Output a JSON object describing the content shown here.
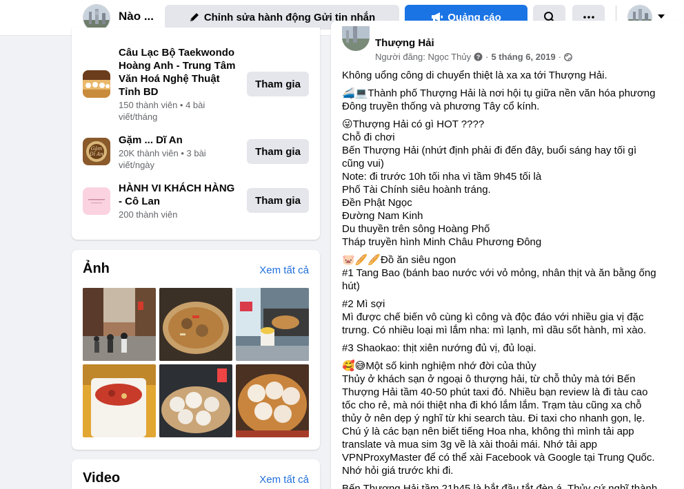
{
  "topbar": {
    "group_name": "Nào ...",
    "edit_label": "Chỉnh sửa hành động Gửi tin nhắn",
    "ads_label": "Quảng cáo",
    "search_icon": "search-icon",
    "more_icon": "more-icon"
  },
  "groups": [
    {
      "title": "Câu Lạc Bộ Taekwondo Hoàng Anh - Trung Tâm Văn Hoá Nghệ Thuật Tỉnh BD",
      "meta": "150 thành viên • 4 bài viết/tháng",
      "join": "Tham gia"
    },
    {
      "title": "Gặm ... Dĩ An",
      "meta": "20K thành viên • 3 bài viết/ngày",
      "join": "Tham gia",
      "thumb_text": "Gặm Dĩ An"
    },
    {
      "title": "HÀNH VI KHÁCH HÀNG - Cô Lan",
      "meta": "200 thành viên",
      "join": "Tham gia"
    }
  ],
  "photos": {
    "title": "Ảnh",
    "see_all": "Xem tất cả"
  },
  "videos": {
    "title": "Video",
    "see_all": "Xem tất cả"
  },
  "post": {
    "author": "Thượng Hải",
    "poster": "Người đăng: Ngọc Thủy",
    "date": "5 tháng 6, 2019",
    "paragraphs": [
      [
        "Không uổng công di chuyển thiệt là xa xa tới Thượng Hải."
      ],
      [
        "🚄💻Thành phố Thượng Hải là nơi hội tụ giữa nền văn hóa phương",
        "Đông truyền thống và phương Tây cổ kính."
      ],
      [
        "😜Thượng Hải có gì HOT ????",
        "Chỗ đi chơi",
        "Bến Thượng Hải (nhứt định phải đi đến đây, buổi sáng hay tối gì",
        "cũng vui)",
        "Note: đi trước 10h tối nha vì tầm 9h45 tối là",
        "Phố Tài Chính siêu hoành tráng.",
        "Đền Phật Ngọc",
        "Đường Nam Kinh",
        "Du thuyền trên sông Hoàng Phố",
        "Tháp truyền hình Minh Châu Phương Đông"
      ],
      [
        "🐷🥖🥖Đồ ăn siêu ngon",
        "#1 Tang Bao (bánh bao nước với vỏ mỏng, nhân thịt và ăn bằng ống",
        "hút)"
      ],
      [
        "#2 Mì sợi",
        "Mì được chế biến vô cùng kì công và độc đáo với nhiều gia vị đặc",
        "trưng. Có nhiều loại mì lắm nha: mì lạnh, mì dầu sốt hành, mì xào."
      ],
      [
        "#3 Shaokao: thịt xiên nướng đủ vị, đủ loại."
      ],
      [
        "🥰😅Một số kinh nghiệm nhớ đời của thủy",
        "Thủy ở khách sạn ở ngoại ô thượng hải, từ chỗ thủy mà tới Bến",
        "Thượng Hải tầm 40-50 phút taxi đó. Nhiều bạn review là đi tàu cao",
        "tốc cho rẻ, mà nói thiệt nha đi khó lắm lắm. Trạm tàu cũng xa chỗ",
        "thủy ở nên dẹp ý nghĩ từ khi search tàu. Đi taxi cho nhanh gọn, lẹ.",
        "Chú ý là các bạn nên biết tiếng Hoa nha, không thì mình tải app",
        "translate và mua sim 3g về là xài thoải mái. Nhớ tải app",
        "VPNProxyMaster để có thể xài Facebook và Google tại Trung Quốc.",
        "Nhớ hỏi giá trước khi đi."
      ],
      [
        "Bến Thượng Hải tầm 21h45 là bắt đầu tắt đèn á. Thủy cứ nghĩ thành"
      ]
    ]
  }
}
